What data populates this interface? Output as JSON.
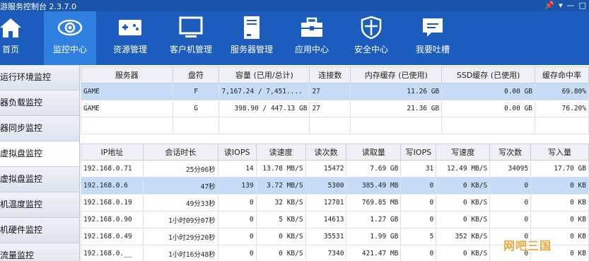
{
  "app": {
    "title": "游服务控制台 2.3.7.0"
  },
  "window_controls": {
    "pin": "📌",
    "menu": "▾",
    "minimize": "—",
    "maximize": "□"
  },
  "toolbar": [
    {
      "label": "首页",
      "icon": "home-icon"
    },
    {
      "label": "监控中心",
      "icon": "eye-icon",
      "active": true
    },
    {
      "label": "资源管理",
      "icon": "gamepad-icon"
    },
    {
      "label": "客户机管理",
      "icon": "monitor-icon"
    },
    {
      "label": "服务器管理",
      "icon": "server-icon"
    },
    {
      "label": "应用中心",
      "icon": "briefcase-icon"
    },
    {
      "label": "安全中心",
      "icon": "shield-icon"
    },
    {
      "label": "我要吐槽",
      "icon": "chat-icon"
    }
  ],
  "sidebar": [
    {
      "label": "器运行环境监控"
    },
    {
      "label": "务器负载监控"
    },
    {
      "label": "务器同步监控"
    },
    {
      "label": "拟虚拟盘监控",
      "active": true
    },
    {
      "label": "户虚拟盘监控"
    },
    {
      "label": "户机温度监控"
    },
    {
      "label": "户机硬件监控"
    },
    {
      "label": "网流量监控"
    }
  ],
  "disk_table": {
    "headers": [
      "服务器",
      "盘符",
      "容量 (已用/总计)",
      "连接数",
      "内存缓存 (已使用)",
      "SSD缓存 (已使用)",
      "缓存命中率"
    ],
    "rows": [
      [
        "GAME",
        "F",
        "7,167.24 / 7,451....",
        "27",
        "11.26 GB",
        "0.00 GB",
        "69.80%"
      ],
      [
        "GAME",
        "G",
        "398.90 / 447.13 GB",
        "27",
        "21.36 GB",
        "0.00 GB",
        "76.20%"
      ],
      [
        "",
        "",
        "",
        "",
        "",
        "",
        ""
      ]
    ],
    "selected_row": 0
  },
  "client_table": {
    "headers": [
      "IP地址",
      "会话时长",
      "读IOPS",
      "读速度",
      "读次数",
      "读取量",
      "写IOPS",
      "写速度",
      "写次数",
      "写入量"
    ],
    "rows": [
      [
        "192.168.0.71",
        "25分06秒",
        "14",
        "13.78 MB/S",
        "15472",
        "7.69 GB",
        "31",
        "12.49 MB/S",
        "34095",
        "17.70 GB"
      ],
      [
        "192.168.0.6",
        "47秒",
        "139",
        "3.72 MB/S",
        "5300",
        "385.49 MB",
        "0",
        "0 KB/S",
        "0",
        "0 KB"
      ],
      [
        "192.168.0.19",
        "49分33秒",
        "0",
        "32 KB/S",
        "12781",
        "769.85 MB",
        "0",
        "0 KB/S",
        "0",
        "0 KB"
      ],
      [
        "192.168.0.90",
        "1小时09分07秒",
        "0",
        "5 KB/S",
        "14613",
        "1.27 GB",
        "0",
        "0 KB/S",
        "0",
        "0 KB"
      ],
      [
        "192.168.0.49",
        "1小时29分20秒",
        "0",
        "0 KB/S",
        "35531",
        "1.99 GB",
        "5",
        "352 KB/S",
        "0",
        "0 KB"
      ],
      [
        "192.168.0.__",
        "1小时16分48秒",
        "0",
        "0 KB/S",
        "7340",
        "421.47 MB",
        "0",
        "0 KB/S",
        "0",
        "0 KB"
      ]
    ],
    "selected_row": 1
  },
  "watermark": "网吧三国"
}
